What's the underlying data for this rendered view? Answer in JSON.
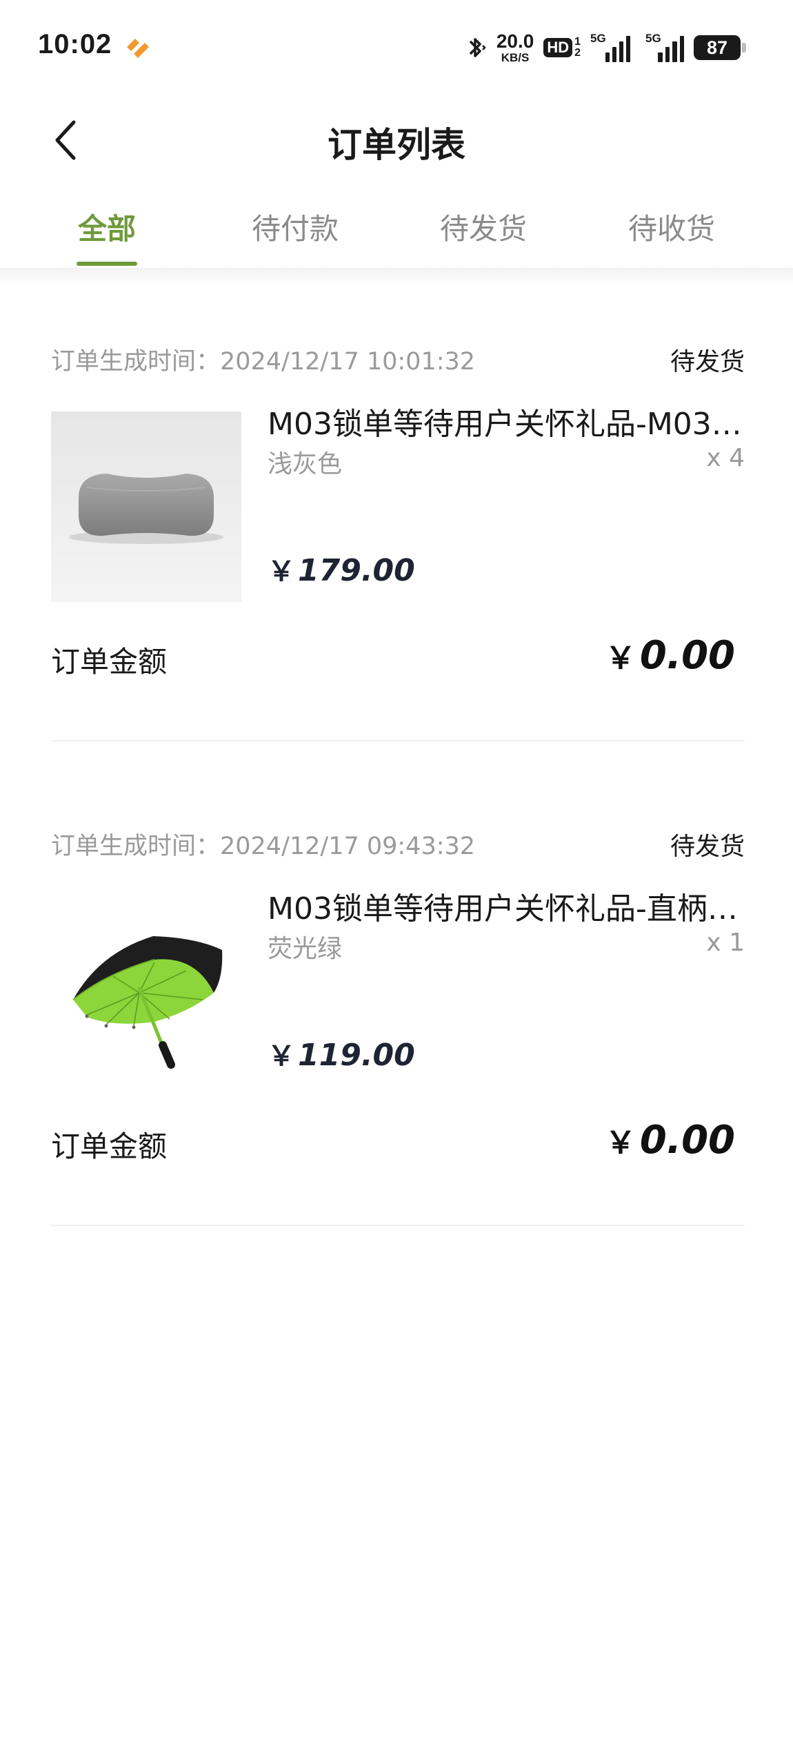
{
  "status_bar": {
    "time": "10:02",
    "net_speed": "20.0",
    "net_unit": "KB/S",
    "hd_label": "HD",
    "hd_sub_top": "1",
    "hd_sub_bottom": "2",
    "signal1_label": "5G",
    "signal2_label": "5G",
    "battery": "87"
  },
  "header": {
    "title": "订单列表"
  },
  "tabs": [
    {
      "label": "全部",
      "active": true
    },
    {
      "label": "待付款",
      "active": false
    },
    {
      "label": "待发货",
      "active": false
    },
    {
      "label": "待收货",
      "active": false
    }
  ],
  "orders": [
    {
      "time_label": "订单生成时间：2024/12/17 10:01:32",
      "status": "待发货",
      "product_name": "M03锁单等待用户关怀礼品-M03…",
      "spec": "浅灰色",
      "qty": "x 4",
      "currency": "￥",
      "price": "179.00",
      "total_label": "订单金额",
      "total_amount": "0.00"
    },
    {
      "time_label": "订单生成时间：2024/12/17 09:43:32",
      "status": "待发货",
      "product_name": "M03锁单等待用户关怀礼品-直柄…",
      "spec": "荧光绿",
      "qty": "x 1",
      "currency": "￥",
      "price": "119.00",
      "total_label": "订单金额",
      "total_amount": "0.00"
    }
  ],
  "colors": {
    "accent": "#6f9a3c",
    "muted_text": "#9a9a9a",
    "price_text": "#1f2433"
  }
}
